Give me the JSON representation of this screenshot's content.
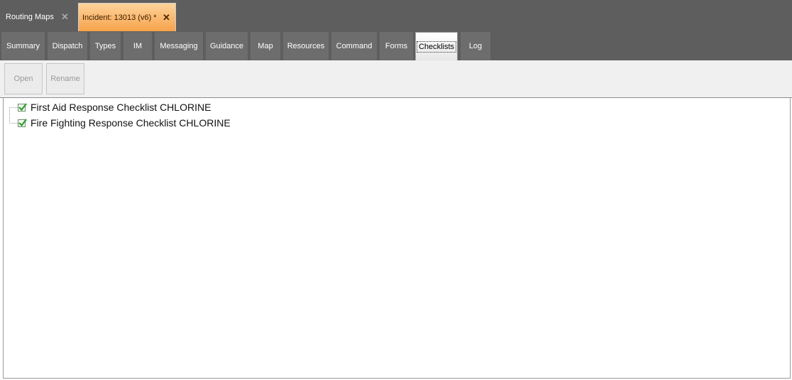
{
  "doc_tabs": [
    {
      "label": "Routing Maps",
      "close": "✕",
      "active": false
    },
    {
      "label": "Incident: 13013 (v6) *",
      "close": "✕",
      "active": true
    }
  ],
  "section_tabs": [
    {
      "label": "Summary"
    },
    {
      "label": "Dispatch"
    },
    {
      "label": "Types"
    },
    {
      "label": "IM"
    },
    {
      "label": "Messaging"
    },
    {
      "label": "Guidance"
    },
    {
      "label": "Map"
    },
    {
      "label": "Resources"
    },
    {
      "label": "Command"
    },
    {
      "label": "Forms"
    },
    {
      "label": "Checklists",
      "active": true
    },
    {
      "label": "Log"
    }
  ],
  "toolbar": {
    "open_label": "Open",
    "rename_label": "Rename"
  },
  "checklists": [
    {
      "label": "First Aid Response Checklist CHLORINE",
      "checked": true
    },
    {
      "label": "Fire Fighting Response Checklist CHLORINE",
      "checked": true
    }
  ],
  "colors": {
    "chrome": "#5e5e5e",
    "active_doc_tab": "#f7a24a",
    "check_mark": "#2e9b2e"
  }
}
